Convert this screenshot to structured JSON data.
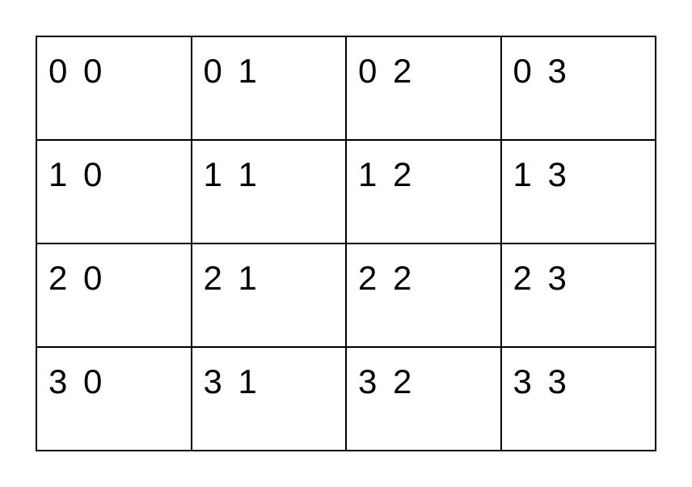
{
  "grid": {
    "rows": [
      [
        "0 0",
        "0 1",
        "0 2",
        "0 3"
      ],
      [
        "1 0",
        "1 1",
        "1 2",
        "1 3"
      ],
      [
        "2 0",
        "2 1",
        "2 2",
        "2 3"
      ],
      [
        "3 0",
        "3 1",
        "3 2",
        "3 3"
      ]
    ]
  }
}
